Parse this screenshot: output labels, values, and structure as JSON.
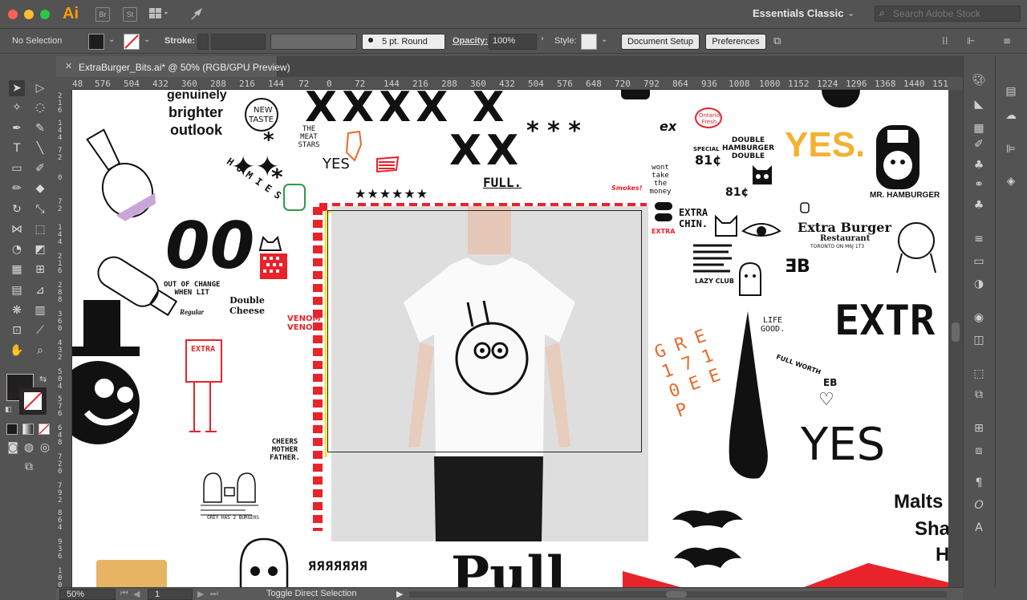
{
  "app": {
    "logo": "Ai",
    "bridge_label": "Br",
    "stock_label": "St",
    "workspace": "Essentials Classic",
    "search_placeholder": "Search Adobe Stock"
  },
  "control_bar": {
    "selection_status": "No Selection",
    "stroke_label": "Stroke:",
    "brush_label": "5 pt. Round",
    "opacity_label": "Opacity:",
    "opacity_value": "100%",
    "style_label": "Style:",
    "document_setup": "Document Setup",
    "preferences": "Preferences"
  },
  "document": {
    "tab_title": "ExtraBurger_Bits.ai* @ 50% (RGB/GPU Preview)"
  },
  "ruler": {
    "h_ticks": [
      "48",
      "576",
      "504",
      "432",
      "360",
      "288",
      "216",
      "144",
      "72",
      "0",
      "72",
      "144",
      "216",
      "288",
      "360",
      "432",
      "504",
      "576",
      "648",
      "720",
      "792",
      "864",
      "936",
      "1008",
      "1080",
      "1152",
      "1224",
      "1296",
      "1368",
      "1440",
      "1512"
    ],
    "v_ticks": [
      "216",
      "144",
      "72",
      "0",
      "72",
      "144",
      "216",
      "288",
      "360",
      "432",
      "504",
      "576",
      "648",
      "720",
      "792",
      "864",
      "936",
      "1008",
      "1080"
    ]
  },
  "artwork": {
    "brighter_1": "genuinely",
    "brighter_2": "brighter",
    "brighter_3": "outlook",
    "new_taste_1": "NEW",
    "new_taste_2": "TASTE",
    "homies": "H O M I E S",
    "meat_stars": "THE MEAT STARS",
    "yes_small": "YES",
    "full": "FULL.",
    "out_of_change_1": "OUT OF CHANGE",
    "out_of_change_2": "WHEN LIT",
    "regular": "Regular",
    "double_cheese_1": "Double",
    "double_cheese_2": "Cheese",
    "venom_1": "VENOM",
    "venom_2": "VENOM",
    "cheers_1": "CHEERS",
    "cheers_2": "MOTHER",
    "cheers_3": "FATHER.",
    "extra_fig": "EXTRA",
    "extra_chin_1": "EXTRA",
    "extra_chin_2": "CHIN.",
    "extra_red": "EXTRA",
    "ontario": "Ontario Fresh",
    "special": "SPECIAL",
    "double_hamburger_1": "DOUBLE",
    "double_hamburger_2": "HAMBURGER",
    "double_hamburger_3": "DOUBLE",
    "price_1": "81¢",
    "price_2": "81¢",
    "wont_take": "wont take the money",
    "smokest": "Smokes!",
    "yes_big": "YES.",
    "mr_hamburger": "MR. HAMBURGER",
    "extra_burger_1": "Extra Burger",
    "extra_burger_2": "Restaurant",
    "extra_burger_3": "TORONTO ON M6J 1T3",
    "life_good_1": "LIFE",
    "life_good_2": "GOOD.",
    "full_worth": "FULL WORTH",
    "grey_digits": "G R E 1 7  1 0 E E P",
    "eb": "EB",
    "yes_hand": "YES",
    "extra_big": "EXTR",
    "malts": "Malts",
    "shakes": "Shak",
    "h_cut": "H",
    "ex": "ex",
    "bottom_script": "Pull",
    "small_caption": "GREY HAS 2 BURGERS",
    "lazy_club": "LAZY CLUB"
  },
  "status_bar": {
    "zoom": "50%",
    "artboard": "1",
    "tool_hint": "Toggle Direct Selection"
  },
  "colors": {
    "accent_red": "#e8232b",
    "accent_yellow": "#f3e23a",
    "accent_orange": "#e86a2a",
    "ai_orange": "#ff9a00",
    "chrome": "#535353"
  }
}
